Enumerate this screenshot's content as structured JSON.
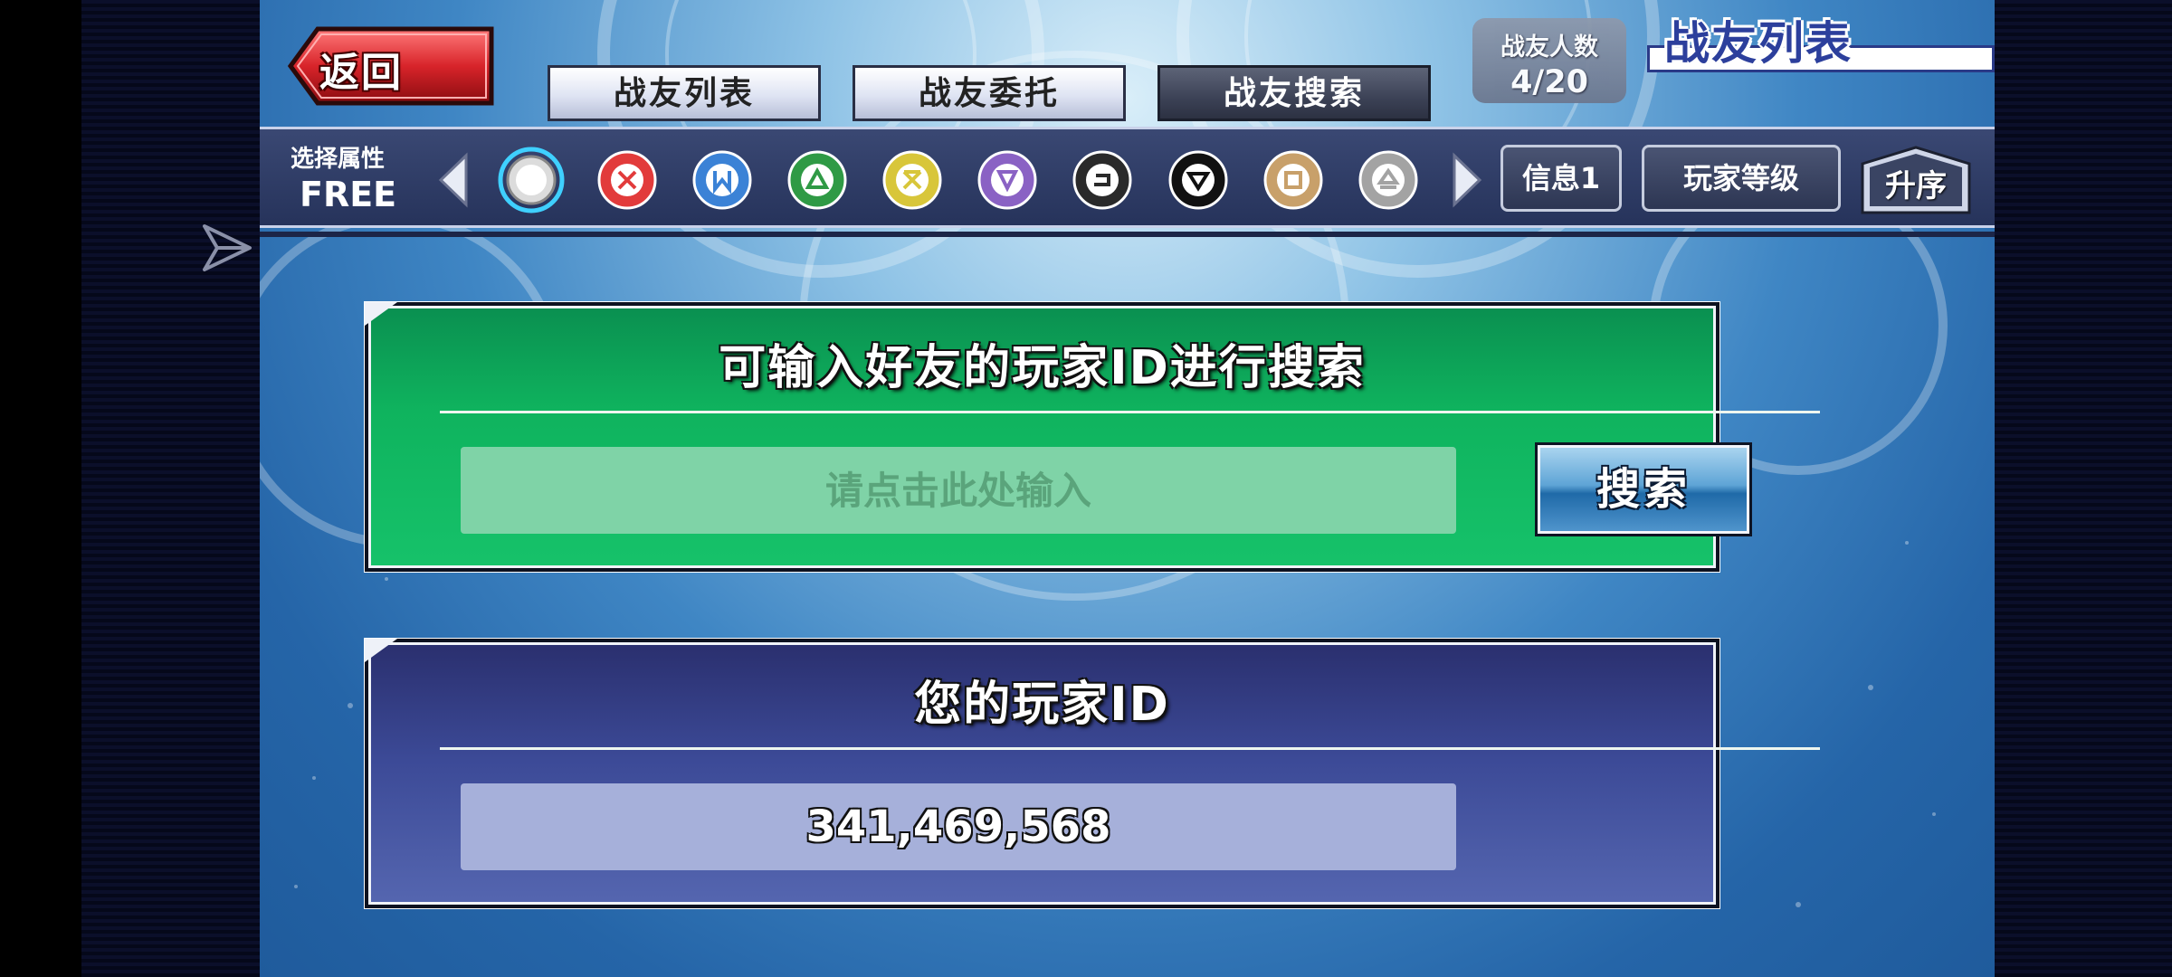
{
  "header": {
    "back_label": "返回",
    "tabs": [
      {
        "label": "战友列表",
        "active": false
      },
      {
        "label": "战友委托",
        "active": false
      },
      {
        "label": "战友搜索",
        "active": true
      }
    ],
    "friend_count_label": "战友人数",
    "friend_count_value": "4/20",
    "screen_title": "战友列表"
  },
  "attribute_bar": {
    "label": "选择属性",
    "value": "FREE",
    "icons": [
      {
        "name": "all-attribute-icon",
        "color": "#ffffff",
        "selected": true
      },
      {
        "name": "fire-attribute-icon",
        "color": "#e23b3b"
      },
      {
        "name": "water-attribute-icon",
        "color": "#3b82d6"
      },
      {
        "name": "earth-attribute-icon",
        "color": "#2f9a45"
      },
      {
        "name": "light-attribute-icon",
        "color": "#d8c63a"
      },
      {
        "name": "wind-attribute-icon",
        "color": "#8a62c4"
      },
      {
        "name": "dark-attribute-icon",
        "color": "#2a2a2a"
      },
      {
        "name": "divine-attribute-icon",
        "color": "#111111"
      },
      {
        "name": "spell-attribute-icon",
        "color": "#c8a06a"
      },
      {
        "name": "trap-attribute-icon",
        "color": "#a3a3a3"
      }
    ],
    "info_label": "信息1",
    "sort_key_label": "玩家等级",
    "order_label": "升序"
  },
  "search_panel": {
    "title": "可输入好友的玩家ID进行搜索",
    "input_placeholder": "请点击此处输入",
    "input_value": "",
    "button_label": "搜索"
  },
  "id_panel": {
    "title": "您的玩家ID",
    "player_id": "341,469,568"
  }
}
